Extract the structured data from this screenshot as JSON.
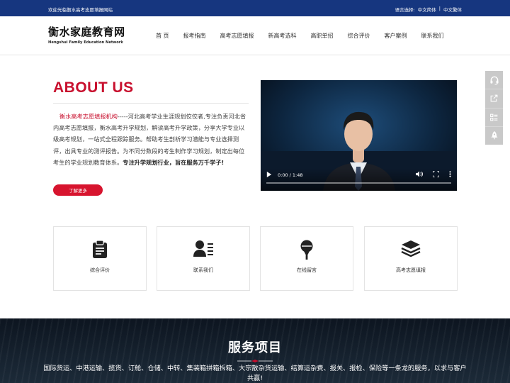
{
  "topbar": {
    "welcome": "欢迎光临衡水高考志愿填报网站",
    "lang_label": "语言选择:",
    "lang_simplified": "中文简体",
    "lang_separator": "|",
    "lang_traditional": "中文繁体"
  },
  "header": {
    "logo_cn": "衡水家庭教育网",
    "logo_en": "Hengshui Family Education Network",
    "nav": [
      "首 页",
      "报考指南",
      "高考志愿填报",
      "新高考选科",
      "高职单招",
      "综合评价",
      "客户案例",
      "联系我们"
    ]
  },
  "about": {
    "title": "ABOUT US",
    "highlight": "衡水高考志愿填报机构",
    "text": "-----河北高考学业生涯规划佼佼者,专注负责河北省内高考志愿填报，衡水高考升学规划，解读高考升学政策，分享大学专业以级高考规划，一站式全程跟踪服务。帮助考生剖析学习潜能与专业选择测评，出具专业的测评报告。为不同分数段的考生制作学习规划，制定出每位考生的学业规划教育体系。",
    "emphasis": "专注升学规划行业，旨在服务万千学子!",
    "more_button": "了解更多"
  },
  "video": {
    "time": "0:00 / 1:48",
    "progress": 0
  },
  "cards": [
    {
      "label": "综合评价",
      "icon": "clipboard-icon"
    },
    {
      "label": "联系我们",
      "icon": "contact-card-icon"
    },
    {
      "label": "在线留言",
      "icon": "microphone-icon"
    },
    {
      "label": "高考志愿填报",
      "icon": "layers-icon"
    }
  ],
  "service": {
    "title": "服务项目",
    "description": "国际货运、中港运输、揽货、订舱、仓储、中转、集装箱拼箱拆箱、大宗散杂货运输、结算运杂费、报关、报检、保险等一条龙的服务，以求与客户共赢!"
  },
  "side_tools": [
    "headset-icon",
    "share-icon",
    "list-icon",
    "rocket-icon"
  ],
  "colors": {
    "topbar": "#16367f",
    "accent_red": "#c8102e",
    "button_red": "#d7142e",
    "side_tool_bg": "#c9c9c9"
  }
}
